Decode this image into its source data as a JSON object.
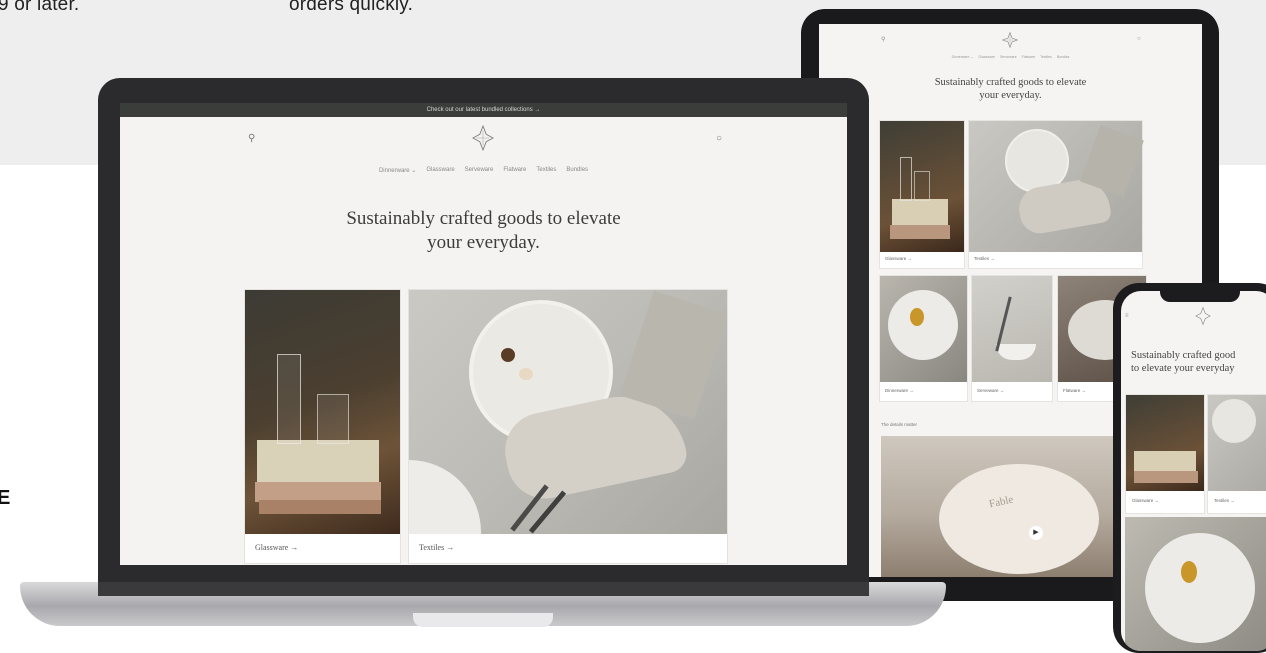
{
  "page": {
    "top_text_left": "9 or later.",
    "top_text_right": "orders quickly.",
    "edge_letter": "E"
  },
  "laptop": {
    "announcement": "Check out our latest bundled collections →",
    "nav": [
      "Dinnerware ⌄",
      "Glassware",
      "Serveware",
      "Flatware",
      "Textiles",
      "Bundles"
    ],
    "headline_line1": "Sustainably crafted goods to elevate",
    "headline_line2": "your everyday.",
    "cards": [
      {
        "label": "Glassware →"
      },
      {
        "label": "Textiles →"
      }
    ]
  },
  "tablet": {
    "nav": [
      "Dinnerware ⌄",
      "Glassware",
      "Serveware",
      "Flatware",
      "Textiles",
      "Bundles"
    ],
    "headline_line1": "Sustainably crafted goods to elevate",
    "headline_line2": "your everyday.",
    "cards_row1": [
      {
        "label": "Glassware →"
      },
      {
        "label": "Textiles →"
      }
    ],
    "cards_row2": [
      {
        "label": "Dinnerware →"
      },
      {
        "label": "Serveware →"
      },
      {
        "label": "Flatware →"
      }
    ],
    "section_label": "The details matter",
    "video_stamp": "Fable"
  },
  "phone": {
    "headline_line1": "Sustainably crafted good",
    "headline_line2": "to elevate your everyday",
    "cards": [
      {
        "label": "Glassware →"
      },
      {
        "label": "Textiles →"
      }
    ]
  }
}
